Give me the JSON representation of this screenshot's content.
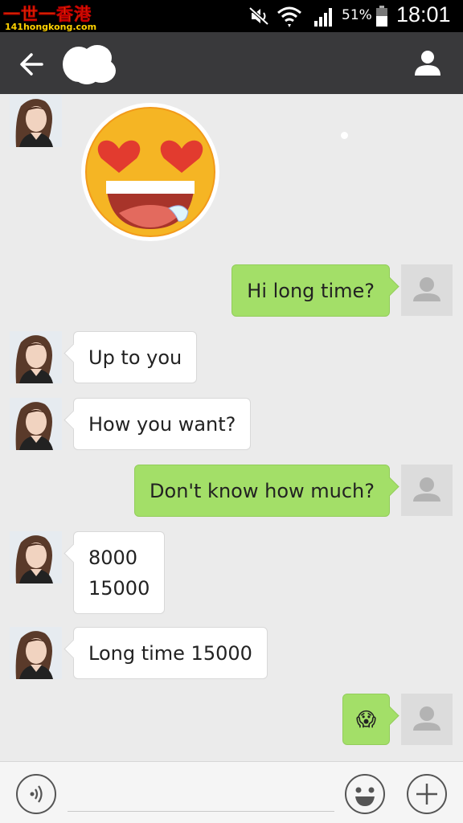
{
  "status_bar": {
    "logo_text": "一世一香港",
    "logo_subtext": "141hongkong.com",
    "battery_percent": "51%",
    "time": "18:01",
    "icons": [
      "mute-icon",
      "wifi-icon",
      "signal-icon",
      "battery-icon"
    ]
  },
  "header": {
    "back_icon": "arrow-left-icon",
    "contact_name": "",
    "profile_icon": "person-icon"
  },
  "messages": [
    {
      "from": "contact",
      "kind": "sticker",
      "sticker": "heart-eyes-face"
    },
    {
      "from": "me",
      "lines": [
        "Hi long time?"
      ]
    },
    {
      "from": "contact",
      "lines": [
        "Up to you"
      ]
    },
    {
      "from": "contact",
      "lines": [
        "How you want?"
      ]
    },
    {
      "from": "me",
      "lines": [
        "Don't know how much?"
      ]
    },
    {
      "from": "contact",
      "lines": [
        "8000",
        "15000"
      ]
    },
    {
      "from": "contact",
      "lines": [
        "Long time 15000"
      ]
    },
    {
      "from": "me",
      "lines": [
        "😱"
      ]
    }
  ],
  "input_bar": {
    "voice_icon": "voice-icon",
    "text_value": "",
    "emoji_icon": "smiley-icon",
    "plus_icon": "plus-icon"
  },
  "colors": {
    "header_bg": "#39393b",
    "chat_bg": "#ebebeb",
    "outgoing_bubble": "#a3df68",
    "incoming_bubble": "#ffffff"
  }
}
